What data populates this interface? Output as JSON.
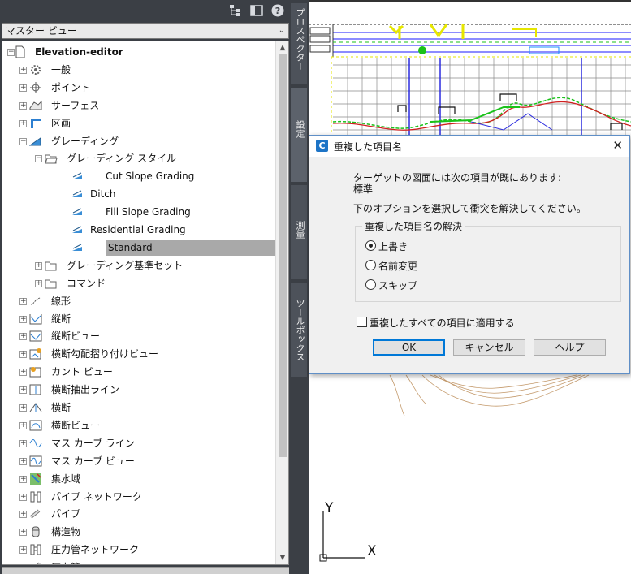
{
  "toolspace": {
    "view_selector": "マスター ビュー",
    "tree": [
      {
        "label": "Elevation-editor",
        "level": 0,
        "expanded": true,
        "icon": "drawing-icon"
      },
      {
        "label": "一般",
        "level": 1,
        "icon": "settings-gear-icon"
      },
      {
        "label": "ポイント",
        "level": 1,
        "icon": "point-icon"
      },
      {
        "label": "サーフェス",
        "level": 1,
        "icon": "surface-icon"
      },
      {
        "label": "区画",
        "level": 1,
        "icon": "parcel-icon"
      },
      {
        "label": "グレーディング",
        "level": 1,
        "expanded": true,
        "icon": "grading-icon"
      },
      {
        "label": "グレーディング スタイル",
        "level": 2,
        "expanded": true,
        "icon": "folder-open-icon"
      },
      {
        "label": "Cut Slope Grading",
        "level": 3,
        "icon": "grading-style-icon"
      },
      {
        "label": "Ditch",
        "level": 3,
        "icon": "grading-style-icon"
      },
      {
        "label": "Fill Slope Grading",
        "level": 3,
        "icon": "grading-style-icon"
      },
      {
        "label": "Residential Grading",
        "level": 3,
        "icon": "grading-style-icon"
      },
      {
        "label": "Standard",
        "level": 3,
        "icon": "grading-style-icon",
        "selected": true
      },
      {
        "label": "グレーディング基準セット",
        "level": 2,
        "icon": "folder-icon"
      },
      {
        "label": "コマンド",
        "level": 2,
        "icon": "folder-icon"
      },
      {
        "label": "線形",
        "level": 1,
        "icon": "alignment-icon"
      },
      {
        "label": "縦断",
        "level": 1,
        "icon": "profile-icon"
      },
      {
        "label": "縦断ビュー",
        "level": 1,
        "icon": "profile-view-icon"
      },
      {
        "label": "横断勾配摺り付けビュー",
        "level": 1,
        "icon": "superelevation-view-icon"
      },
      {
        "label": "カント ビュー",
        "level": 1,
        "icon": "cant-view-icon"
      },
      {
        "label": "横断抽出ライン",
        "level": 1,
        "icon": "sample-line-icon"
      },
      {
        "label": "横断",
        "level": 1,
        "icon": "section-icon"
      },
      {
        "label": "横断ビュー",
        "level": 1,
        "icon": "section-view-icon"
      },
      {
        "label": "マス カーブ ライン",
        "level": 1,
        "icon": "mass-haul-line-icon"
      },
      {
        "label": "マス カーブ ビュー",
        "level": 1,
        "icon": "mass-haul-view-icon"
      },
      {
        "label": "集水域",
        "level": 1,
        "icon": "catchment-icon"
      },
      {
        "label": "パイプ ネットワーク",
        "level": 1,
        "icon": "pipe-network-icon"
      },
      {
        "label": "パイプ",
        "level": 1,
        "icon": "pipe-icon"
      },
      {
        "label": "構造物",
        "level": 1,
        "icon": "structure-icon"
      },
      {
        "label": "圧力管ネットワーク",
        "level": 1,
        "icon": "pressure-network-icon"
      },
      {
        "label": "圧力管",
        "level": 1,
        "icon": "pressure-pipe-icon"
      }
    ]
  },
  "side_tabs": [
    "プロスペクター",
    "設定",
    "測量",
    "ツールボックス"
  ],
  "drawing": {
    "ucs_y": "Y",
    "ucs_x": "X"
  },
  "dialog": {
    "title": "重複した項目名",
    "message": "ターゲットの図面には次の項目が既にあります:",
    "item_name": "標準",
    "instruction": "下のオプションを選択して衝突を解決してください。",
    "group_label": "重複した項目名の解決",
    "options": [
      {
        "label": "上書き",
        "selected": true
      },
      {
        "label": "名前変更",
        "selected": false
      },
      {
        "label": "スキップ",
        "selected": false
      }
    ],
    "apply_all_label": "重複したすべての項目に適用する",
    "apply_all_checked": false,
    "buttons": {
      "ok": "OK",
      "cancel": "キャンセル",
      "help": "ヘルプ"
    }
  },
  "colors": {
    "ui_dark": "#3b3f45",
    "selection": "#a9a9a9",
    "accent_blue": "#0078d7"
  }
}
